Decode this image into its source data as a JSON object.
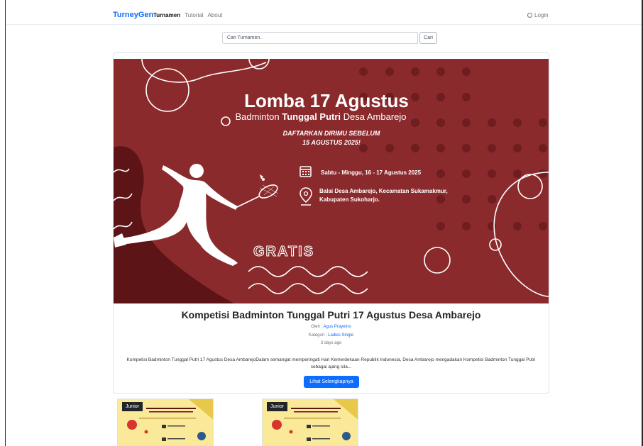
{
  "navbar": {
    "brand": "TurneyGen",
    "links": [
      {
        "label": "Turnamen",
        "active": true
      },
      {
        "label": "Tutorial",
        "active": false
      },
      {
        "label": "About",
        "active": false
      }
    ],
    "login_label": "Login",
    "login_icon": "login-icon"
  },
  "search": {
    "placeholder": "Cari Turnamen..",
    "value": "",
    "button_label": "Cari"
  },
  "featured": {
    "banner": {
      "title": "Lomba 17 Agustus",
      "subtitle_pre": "Badminton ",
      "subtitle_bold": "Tunggal Putri",
      "subtitle_post": " Desa Ambarejo",
      "deadline_line1": "DAFTARKAN DIRIMU SEBELUM",
      "deadline_line2": "15 AGUSTUS 2025!",
      "date_text": "Sabtu - Minggu, 16 - 17 Agustus 2025",
      "location_line1": "Balai Desa Ambarejo, Kecamatan Sukamakmur,",
      "location_line2": "Kabupaten Sukoharjo.",
      "free_text": "GRATIS",
      "colors": {
        "background": "#8b2a2c",
        "dark": "#5c1416",
        "dots": "#6e1d20",
        "text": "#ffffff"
      }
    },
    "title": "Kompetisi Badminton Tunggal Putri 17 Agustus Desa Ambarejo",
    "author_prefix": "Oleh : ",
    "author": "Agus Prayetno",
    "category_prefix": "Kategori : ",
    "category": "Ladies Single",
    "time_ago": "3 days ago",
    "description": "Kompetisi Badminton Tunggal Putri 17 Agustus Desa AmbarejoDalam semangat memperingati Hari Kemerdekaan Republik Indonesia, Desa Ambarejo mengadakan Kompetisi Badminton Tunggal Putri sebagai ajang sila...",
    "cta_label": "Lihat Selengkapnya"
  },
  "thumbnails": [
    {
      "tag": "Junior"
    },
    {
      "tag": "Junior"
    }
  ],
  "colors": {
    "accent": "#0d6efd",
    "thumb_bg": "#fbe99a"
  }
}
